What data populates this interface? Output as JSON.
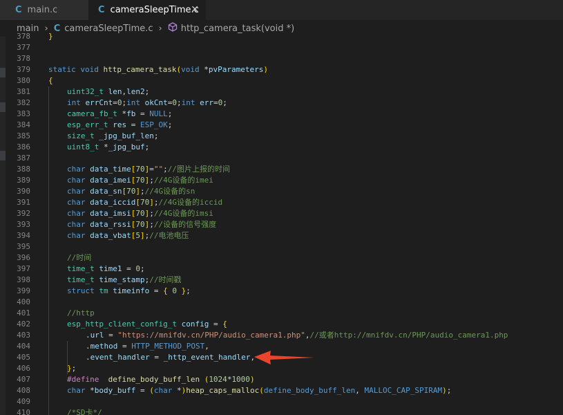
{
  "tabs": [
    {
      "icon": "C",
      "label": "main.c",
      "active": false
    },
    {
      "icon": "C",
      "label": "cameraSleepTime.c",
      "active": true,
      "close": "✕"
    }
  ],
  "breadcrumb": {
    "root": "main",
    "file_icon": "C",
    "file": "cameraSleepTime.c",
    "symbol": "http_camera_task(void *)",
    "separator": "›"
  },
  "colors": {
    "background": "#1e1e1e",
    "keyword": "#569cd6",
    "type": "#4ec9b0",
    "function": "#dcdcaa",
    "variable": "#9cdcfe",
    "string": "#ce9178",
    "number": "#b5cea8",
    "comment": "#6a9955",
    "annotation_arrow": "#e8452c"
  },
  "code_lines": [
    {
      "n": "378",
      "indent": 0,
      "tokens": [
        [
          "br",
          "}"
        ]
      ]
    },
    {
      "n": "377",
      "indent": 0,
      "tokens": []
    },
    {
      "n": "378",
      "indent": 0,
      "tokens": []
    },
    {
      "n": "379",
      "indent": 0,
      "tokens": [
        [
          "kw",
          "static"
        ],
        [
          "op",
          " "
        ],
        [
          "kw",
          "void"
        ],
        [
          "op",
          " "
        ],
        [
          "fn",
          "http_camera_task"
        ],
        [
          "br",
          "("
        ],
        [
          "kw",
          "void"
        ],
        [
          "op",
          " *"
        ],
        [
          "va",
          "pvParameters"
        ],
        [
          "br",
          ")"
        ]
      ]
    },
    {
      "n": "380",
      "indent": 0,
      "tokens": [
        [
          "br",
          "{"
        ]
      ]
    },
    {
      "n": "381",
      "indent": 1,
      "tokens": [
        [
          "ty",
          "uint32_t"
        ],
        [
          "op",
          " "
        ],
        [
          "va",
          "len"
        ],
        [
          "op",
          ","
        ],
        [
          "va",
          "len2"
        ],
        [
          "op",
          ";"
        ]
      ]
    },
    {
      "n": "382",
      "indent": 1,
      "tokens": [
        [
          "kw",
          "int"
        ],
        [
          "op",
          " "
        ],
        [
          "va",
          "errCnt"
        ],
        [
          "op",
          "="
        ],
        [
          "nm",
          "0"
        ],
        [
          "op",
          ";"
        ],
        [
          "kw",
          "int"
        ],
        [
          "op",
          " "
        ],
        [
          "va",
          "okCnt"
        ],
        [
          "op",
          "="
        ],
        [
          "nm",
          "0"
        ],
        [
          "op",
          ";"
        ],
        [
          "kw",
          "int"
        ],
        [
          "op",
          " "
        ],
        [
          "va",
          "err"
        ],
        [
          "op",
          "="
        ],
        [
          "nm",
          "0"
        ],
        [
          "op",
          ";"
        ]
      ]
    },
    {
      "n": "383",
      "indent": 1,
      "tokens": [
        [
          "ty",
          "camera_fb_t"
        ],
        [
          "op",
          " *"
        ],
        [
          "va",
          "fb"
        ],
        [
          "op",
          " = "
        ],
        [
          "mc",
          "NULL"
        ],
        [
          "op",
          ";"
        ]
      ]
    },
    {
      "n": "384",
      "indent": 1,
      "tokens": [
        [
          "ty",
          "esp_err_t"
        ],
        [
          "op",
          " "
        ],
        [
          "va",
          "res"
        ],
        [
          "op",
          " = "
        ],
        [
          "mc",
          "ESP_OK"
        ],
        [
          "op",
          ";"
        ]
      ]
    },
    {
      "n": "385",
      "indent": 1,
      "tokens": [
        [
          "ty",
          "size_t"
        ],
        [
          "op",
          " "
        ],
        [
          "va",
          "_jpg_buf_len"
        ],
        [
          "op",
          ";"
        ]
      ]
    },
    {
      "n": "386",
      "indent": 1,
      "tokens": [
        [
          "ty",
          "uint8_t"
        ],
        [
          "op",
          " *"
        ],
        [
          "va",
          "_jpg_buf"
        ],
        [
          "op",
          ";"
        ]
      ]
    },
    {
      "n": "387",
      "indent": 0,
      "tokens": []
    },
    {
      "n": "388",
      "indent": 1,
      "tokens": [
        [
          "kw",
          "char"
        ],
        [
          "op",
          " "
        ],
        [
          "va",
          "data_time"
        ],
        [
          "br",
          "["
        ],
        [
          "nm",
          "70"
        ],
        [
          "br",
          "]"
        ],
        [
          "op",
          "="
        ],
        [
          "st",
          "\"\""
        ],
        [
          "op",
          ";"
        ],
        [
          "cm",
          "//图片上报的时间"
        ]
      ]
    },
    {
      "n": "389",
      "indent": 1,
      "tokens": [
        [
          "kw",
          "char"
        ],
        [
          "op",
          " "
        ],
        [
          "va",
          "data_imei"
        ],
        [
          "br",
          "["
        ],
        [
          "nm",
          "70"
        ],
        [
          "br",
          "]"
        ],
        [
          "op",
          ";"
        ],
        [
          "cm",
          "//4G设备的imei"
        ]
      ]
    },
    {
      "n": "390",
      "indent": 1,
      "tokens": [
        [
          "kw",
          "char"
        ],
        [
          "op",
          " "
        ],
        [
          "va",
          "data_sn"
        ],
        [
          "br",
          "["
        ],
        [
          "nm",
          "70"
        ],
        [
          "br",
          "]"
        ],
        [
          "op",
          ";"
        ],
        [
          "cm",
          "//4G设备的sn"
        ]
      ]
    },
    {
      "n": "391",
      "indent": 1,
      "tokens": [
        [
          "kw",
          "char"
        ],
        [
          "op",
          " "
        ],
        [
          "va",
          "data_iccid"
        ],
        [
          "br",
          "["
        ],
        [
          "nm",
          "70"
        ],
        [
          "br",
          "]"
        ],
        [
          "op",
          ";"
        ],
        [
          "cm",
          "//4G设备的iccid"
        ]
      ]
    },
    {
      "n": "392",
      "indent": 1,
      "tokens": [
        [
          "kw",
          "char"
        ],
        [
          "op",
          " "
        ],
        [
          "va",
          "data_imsi"
        ],
        [
          "br",
          "["
        ],
        [
          "nm",
          "70"
        ],
        [
          "br",
          "]"
        ],
        [
          "op",
          ";"
        ],
        [
          "cm",
          "//4G设备的imsi"
        ]
      ]
    },
    {
      "n": "393",
      "indent": 1,
      "tokens": [
        [
          "kw",
          "char"
        ],
        [
          "op",
          " "
        ],
        [
          "va",
          "data_rssi"
        ],
        [
          "br",
          "["
        ],
        [
          "nm",
          "70"
        ],
        [
          "br",
          "]"
        ],
        [
          "op",
          ";"
        ],
        [
          "cm",
          "//设备的信号强度"
        ]
      ]
    },
    {
      "n": "394",
      "indent": 1,
      "tokens": [
        [
          "kw",
          "char"
        ],
        [
          "op",
          " "
        ],
        [
          "va",
          "data_vbat"
        ],
        [
          "br",
          "["
        ],
        [
          "nm",
          "5"
        ],
        [
          "br",
          "]"
        ],
        [
          "op",
          ";"
        ],
        [
          "cm",
          "//电池电压"
        ]
      ]
    },
    {
      "n": "395",
      "indent": 0,
      "tokens": []
    },
    {
      "n": "396",
      "indent": 1,
      "tokens": [
        [
          "cm",
          "//时间"
        ]
      ]
    },
    {
      "n": "397",
      "indent": 1,
      "tokens": [
        [
          "ty",
          "time_t"
        ],
        [
          "op",
          " "
        ],
        [
          "va",
          "time1"
        ],
        [
          "op",
          " = "
        ],
        [
          "nm",
          "0"
        ],
        [
          "op",
          ";"
        ]
      ]
    },
    {
      "n": "398",
      "indent": 1,
      "tokens": [
        [
          "ty",
          "time_t"
        ],
        [
          "op",
          " "
        ],
        [
          "va",
          "time_stamp"
        ],
        [
          "op",
          ";"
        ],
        [
          "cm",
          "//时间戳"
        ]
      ]
    },
    {
      "n": "399",
      "indent": 1,
      "tokens": [
        [
          "kw",
          "struct"
        ],
        [
          "op",
          " "
        ],
        [
          "ty",
          "tm"
        ],
        [
          "op",
          " "
        ],
        [
          "va",
          "timeinfo"
        ],
        [
          "op",
          " = "
        ],
        [
          "br",
          "{"
        ],
        [
          "op",
          " "
        ],
        [
          "nm",
          "0"
        ],
        [
          "op",
          " "
        ],
        [
          "br",
          "}"
        ],
        [
          "op",
          ";"
        ]
      ]
    },
    {
      "n": "400",
      "indent": 0,
      "tokens": []
    },
    {
      "n": "401",
      "indent": 1,
      "tokens": [
        [
          "cm",
          "//http"
        ]
      ]
    },
    {
      "n": "402",
      "indent": 1,
      "tokens": [
        [
          "ty",
          "esp_http_client_config_t"
        ],
        [
          "op",
          " "
        ],
        [
          "va",
          "config"
        ],
        [
          "op",
          " = "
        ],
        [
          "br",
          "{"
        ]
      ]
    },
    {
      "n": "403",
      "indent": 2,
      "tokens": [
        [
          "op",
          "."
        ],
        [
          "va",
          "url"
        ],
        [
          "op",
          " = "
        ],
        [
          "st",
          "\"https://mnifdv.cn/PHP/audio_camera1.php\""
        ],
        [
          "op",
          ","
        ],
        [
          "cm",
          "//或者http://mnifdv.cn/PHP/audio_camera1.php"
        ]
      ]
    },
    {
      "n": "404",
      "indent": 2,
      "tokens": [
        [
          "op",
          "."
        ],
        [
          "va",
          "method"
        ],
        [
          "op",
          " = "
        ],
        [
          "mc",
          "HTTP_METHOD_POST"
        ],
        [
          "op",
          ","
        ]
      ]
    },
    {
      "n": "405",
      "indent": 2,
      "tokens": [
        [
          "op",
          "."
        ],
        [
          "va",
          "event_handler"
        ],
        [
          "op",
          " = "
        ],
        [
          "va",
          "_http_event_handler"
        ],
        [
          "op",
          ","
        ]
      ]
    },
    {
      "n": "406",
      "indent": 1,
      "tokens": [
        [
          "br",
          "}"
        ],
        [
          "op",
          ";"
        ]
      ]
    },
    {
      "n": "407",
      "indent": 1,
      "tokens": [
        [
          "pp",
          "#define"
        ],
        [
          "op",
          "  "
        ],
        [
          "fn",
          "define_body_buff_len"
        ],
        [
          "op",
          " "
        ],
        [
          "br",
          "("
        ],
        [
          "nm",
          "1024"
        ],
        [
          "op",
          "*"
        ],
        [
          "nm",
          "1000"
        ],
        [
          "br",
          ")"
        ]
      ]
    },
    {
      "n": "408",
      "indent": 1,
      "tokens": [
        [
          "kw",
          "char"
        ],
        [
          "op",
          " *"
        ],
        [
          "va",
          "body_buff"
        ],
        [
          "op",
          " = "
        ],
        [
          "br",
          "("
        ],
        [
          "kw",
          "char"
        ],
        [
          "op",
          " *"
        ],
        [
          "br",
          ")"
        ],
        [
          "fn",
          "heap_caps_malloc"
        ],
        [
          "br",
          "("
        ],
        [
          "mc",
          "define_body_buff_len"
        ],
        [
          "op",
          ", "
        ],
        [
          "mc",
          "MALLOC_CAP_SPIRAM"
        ],
        [
          "br",
          ")"
        ],
        [
          "op",
          ";"
        ]
      ]
    },
    {
      "n": "409",
      "indent": 0,
      "tokens": []
    },
    {
      "n": "410",
      "indent": 1,
      "tokens": [
        [
          "cm",
          "/*SD卡*/"
        ]
      ]
    }
  ]
}
